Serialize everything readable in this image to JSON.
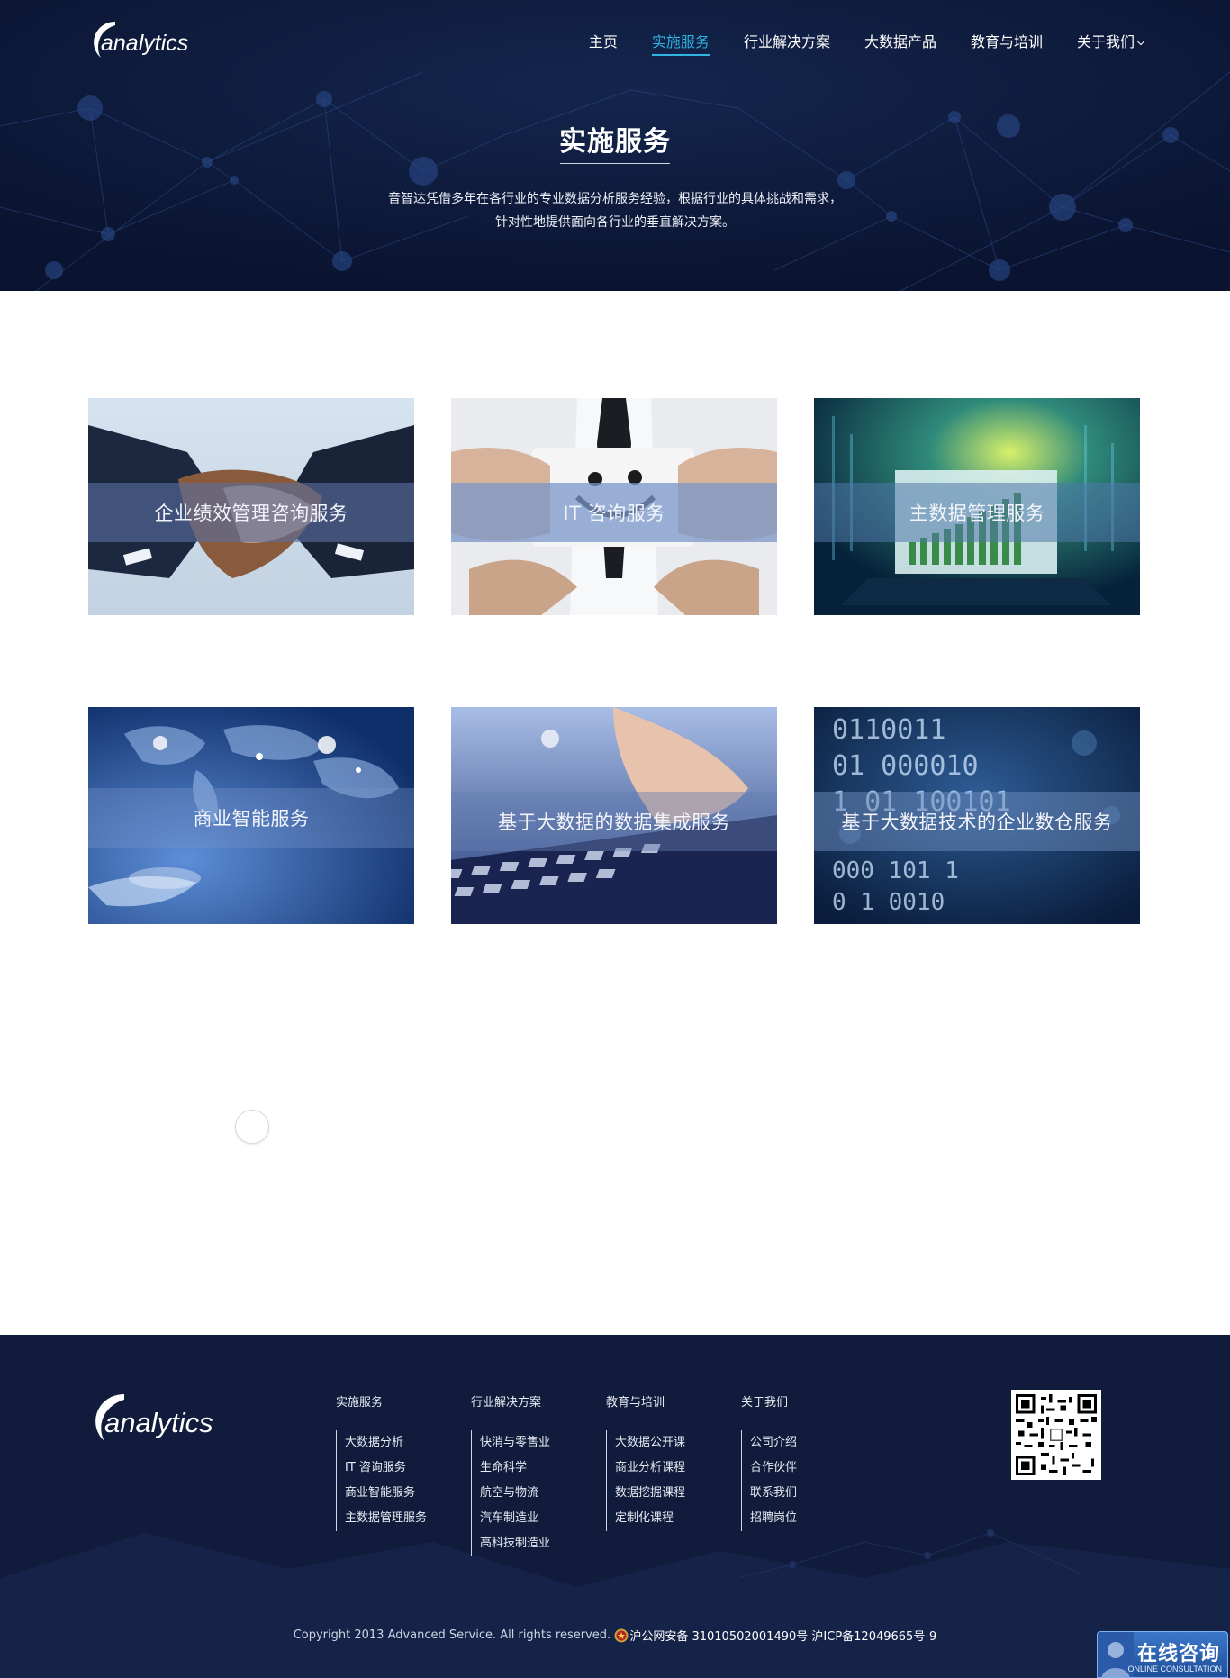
{
  "brand": {
    "logo_text": "analytics"
  },
  "nav": [
    {
      "label": "主页",
      "active": false
    },
    {
      "label": "实施服务",
      "active": true
    },
    {
      "label": "行业解决方案",
      "active": false
    },
    {
      "label": "大数据产品",
      "active": false
    },
    {
      "label": "教育与培训",
      "active": false
    },
    {
      "label": "关于我们",
      "active": false,
      "dropdown": true
    }
  ],
  "hero": {
    "title": "实施服务",
    "desc_line1": "音智达凭借多年在各行业的专业数据分析服务经验，根据行业的具体挑战和需求，",
    "desc_line2": "针对性地提供面向各行业的垂直解决方案。"
  },
  "services": [
    {
      "label": "企业绩效管理咨询服务",
      "image": "handshake"
    },
    {
      "label": "IT 咨询服务",
      "image": "smiley-card"
    },
    {
      "label": "主数据管理服务",
      "image": "laptop-chart"
    },
    {
      "label": "商业智能服务",
      "image": "world-map-hand"
    },
    {
      "label": "基于大数据的数据集成服务",
      "image": "keyboard-typing"
    },
    {
      "label": "基于大数据技术的企业数仓服务",
      "image": "binary-digits"
    }
  ],
  "footer": {
    "logo_text": "analytics",
    "columns": [
      {
        "head": "实施服务",
        "links": [
          "大数据分析",
          "IT 咨询服务",
          "商业智能服务",
          "主数据管理服务"
        ]
      },
      {
        "head": "行业解决方案",
        "links": [
          "快消与零售业",
          "生命科学",
          "航空与物流",
          "汽车制造业",
          "高科技制造业"
        ]
      },
      {
        "head": "教育与培训",
        "links": [
          "大数据公开课",
          "商业分析课程",
          "数据挖掘课程",
          "定制化课程"
        ]
      },
      {
        "head": "关于我们",
        "links": [
          "公司介绍",
          "合作伙伴",
          "联系我们",
          "招聘岗位"
        ]
      }
    ],
    "copyright": "Copyright 2013 Advanced Service. All rights reserved.",
    "police_record": "沪公网安备 31010502001490号",
    "icp": "沪ICP备12049665号-9"
  },
  "consult": {
    "cn": "在线咨询",
    "en": "ONLINE CONSULTATION"
  },
  "colors": {
    "hero_bg": "#0b1733",
    "accent": "#2fb5e0",
    "footer_bg": "#111c3d"
  }
}
